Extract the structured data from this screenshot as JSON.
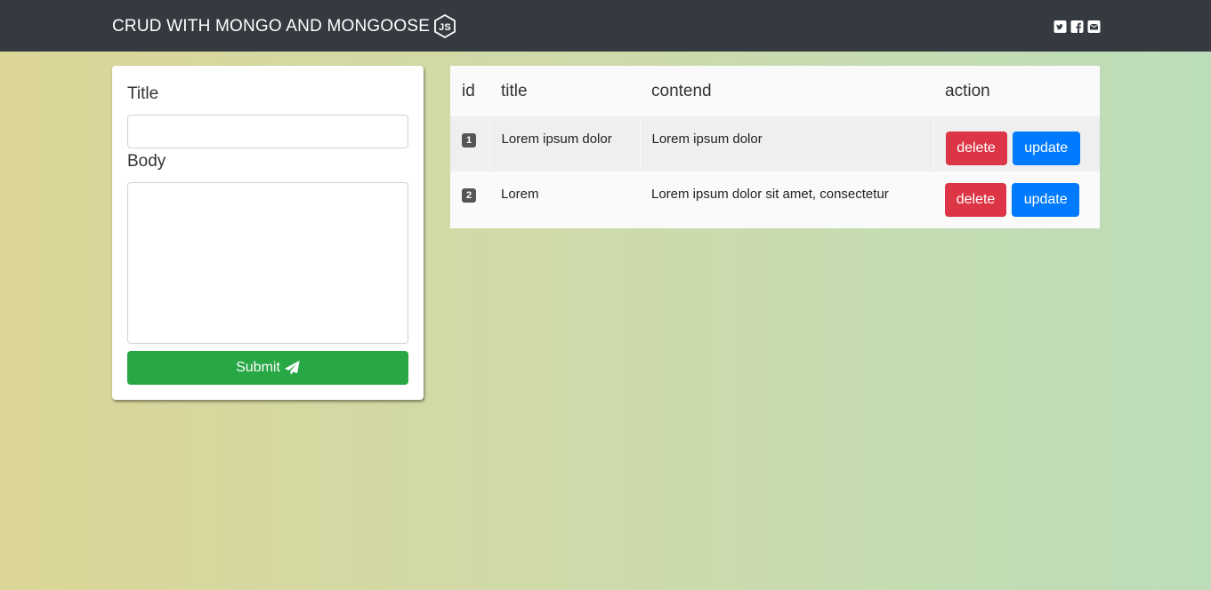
{
  "navbar": {
    "brand": "CRUD WITH MONGO AND MONGOOSE",
    "brand_icon": "nodejs-logo-icon",
    "social_icons": [
      "twitter-square-icon",
      "facebook-square-icon",
      "envelope-square-icon"
    ]
  },
  "form": {
    "title_label": "Title",
    "title_value": "",
    "body_label": "Body",
    "body_value": "",
    "submit_label": "Submit",
    "submit_icon": "paper-plane-icon"
  },
  "table": {
    "headers": [
      "id",
      "title",
      "contend",
      "action"
    ],
    "rows": [
      {
        "id": "1",
        "title": "Lorem ipsum dolor",
        "content": "Lorem ipsum dolor",
        "delete_label": "delete",
        "update_label": "update"
      },
      {
        "id": "2",
        "title": "Lorem",
        "content": "Lorem ipsum dolor sit amet, consectetur",
        "delete_label": "delete",
        "update_label": "update"
      }
    ]
  },
  "colors": {
    "navbar": "#343a40",
    "success": "#28a745",
    "danger": "#dc3545",
    "primary": "#007bff"
  }
}
